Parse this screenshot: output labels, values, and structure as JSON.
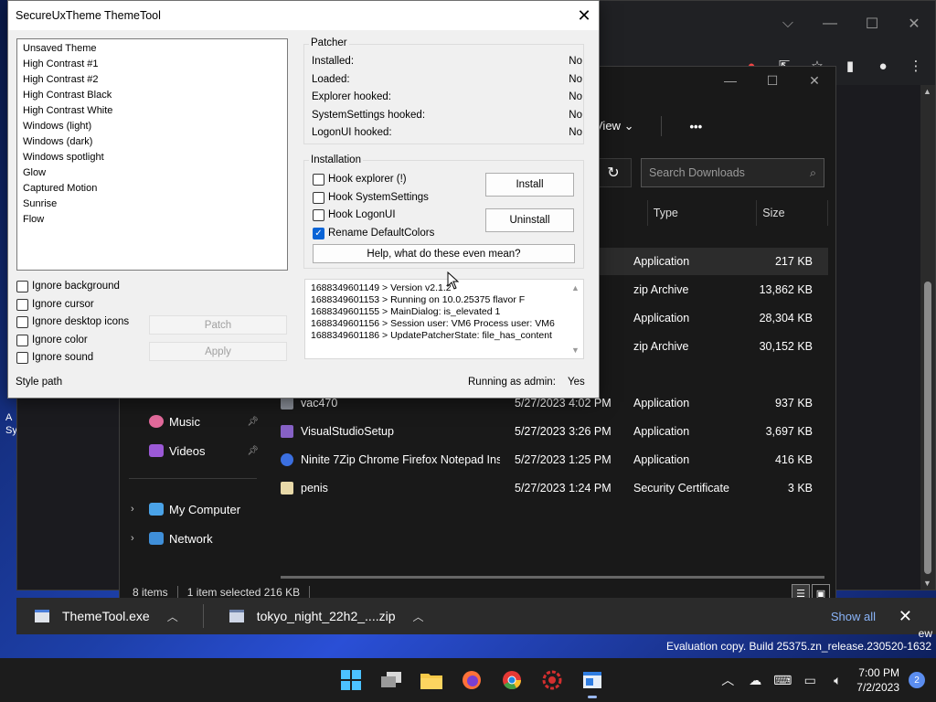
{
  "desktop": {
    "left_label_1": "A",
    "left_label_2": "Sy"
  },
  "browser": {
    "controls": {
      "chevron": "⌵",
      "minimize": "—",
      "maximize": "☐",
      "close": "✕"
    }
  },
  "explorer": {
    "controls": {
      "minimize": "—",
      "maximize": "☐",
      "close": "✕"
    },
    "view_label": "View",
    "more_label": "•••",
    "search_placeholder": "Search Downloads",
    "columns": {
      "type": "Type",
      "size": "Size"
    },
    "rows": [
      {
        "name": "",
        "date": "",
        "type": "Application",
        "size": "217 KB",
        "selected": true
      },
      {
        "name": "",
        "date": "",
        "type": "zip Archive",
        "size": "13,862 KB"
      },
      {
        "name": "",
        "date": "",
        "type": "Application",
        "size": "28,304 KB"
      },
      {
        "name": "",
        "date": "",
        "type": "zip Archive",
        "size": "30,152 KB"
      },
      {
        "name": "vac470",
        "date": "5/27/2023 4:02 PM",
        "type": "Application",
        "size": "937 KB"
      },
      {
        "name": "VisualStudioSetup",
        "date": "5/27/2023 3:26 PM",
        "type": "Application",
        "size": "3,697 KB"
      },
      {
        "name": "Ninite 7Zip Chrome Firefox Notepad Inst...",
        "date": "5/27/2023 1:25 PM",
        "type": "Application",
        "size": "416 KB"
      },
      {
        "name": "penis",
        "date": "5/27/2023 1:24 PM",
        "type": "Security Certificate",
        "size": "3 KB"
      }
    ],
    "nav": {
      "music": "Music",
      "videos": "Videos",
      "my_computer": "My Computer",
      "network": "Network"
    },
    "status": {
      "items": "8 items",
      "selected": "1 item selected  216 KB"
    }
  },
  "downloads_bar": {
    "items": [
      {
        "label": "ThemeTool.exe"
      },
      {
        "label": "tokyo_night_22h2_....zip"
      }
    ],
    "show_all": "Show all",
    "close": "✕"
  },
  "eval": {
    "line_top": "ew",
    "build": "Evaluation copy. Build 25375.zn_release.230520-1632"
  },
  "dialog": {
    "title": "SecureUxTheme ThemeTool",
    "close": "✕",
    "themes": [
      "Unsaved Theme",
      "High Contrast #1",
      "High Contrast #2",
      "High Contrast Black",
      "High Contrast White",
      "Windows (light)",
      "Windows (dark)",
      "Windows spotlight",
      "Glow",
      "Captured Motion",
      "Sunrise",
      "Flow"
    ],
    "ignore_options": {
      "background": "Ignore background",
      "cursor": "Ignore cursor",
      "desktop_icons": "Ignore desktop icons",
      "color": "Ignore color",
      "sound": "Ignore sound"
    },
    "buttons": {
      "patch": "Patch",
      "apply": "Apply",
      "install": "Install",
      "uninstall": "Uninstall",
      "help": "Help, what do these even mean?"
    },
    "patcher": {
      "label": "Patcher",
      "rows": [
        {
          "key": "Installed:",
          "value": "No"
        },
        {
          "key": "Loaded:",
          "value": "No"
        },
        {
          "key": "Explorer hooked:",
          "value": "No"
        },
        {
          "key": "SystemSettings hooked:",
          "value": "No"
        },
        {
          "key": "LogonUI hooked:",
          "value": "No"
        }
      ]
    },
    "installation": {
      "label": "Installation",
      "hook_explorer": "Hook explorer (!)",
      "hook_systemsettings": "Hook SystemSettings",
      "hook_logonui": "Hook LogonUI",
      "rename_defaultcolors": "Rename DefaultColors",
      "rename_checked": true
    },
    "log": [
      "1688349601149 > Version v2.1.2",
      "1688349601153 > Running on 10.0.25375 flavor F",
      "1688349601155 > MainDialog: is_elevated 1",
      "1688349601156 > Session user: VM6 Process user: VM6",
      "1688349601186 > UpdatePatcherState: file_has_content"
    ],
    "style_path": "Style path",
    "running_as_admin_label": "Running as admin:",
    "running_as_admin_value": "Yes"
  },
  "taskbar": {
    "time": "7:00 PM",
    "date": "7/2/2023",
    "notification_count": "2"
  }
}
